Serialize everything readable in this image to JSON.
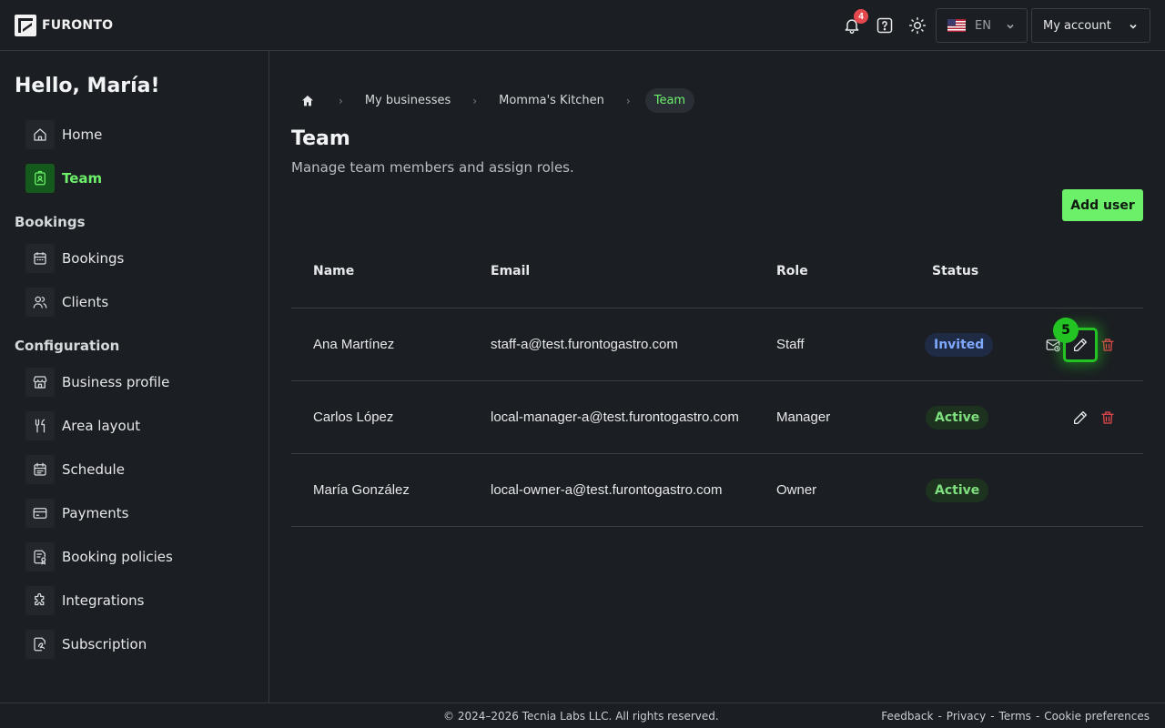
{
  "header": {
    "brand": "FURONTO",
    "notifications_count": "4",
    "language": "EN",
    "account_label": "My account"
  },
  "sidebar": {
    "greeting": "Hello, María!",
    "top_items": [
      {
        "label": "Home",
        "icon": "home-icon"
      },
      {
        "label": "Team",
        "icon": "badge-icon",
        "active": true
      }
    ],
    "bookings_section": "Bookings",
    "bookings_items": [
      {
        "label": "Bookings",
        "icon": "calendar-icon"
      },
      {
        "label": "Clients",
        "icon": "users-icon"
      }
    ],
    "config_section": "Configuration",
    "config_items": [
      {
        "label": "Business profile",
        "icon": "store-icon"
      },
      {
        "label": "Area layout",
        "icon": "utensils-icon"
      },
      {
        "label": "Schedule",
        "icon": "schedule-icon"
      },
      {
        "label": "Payments",
        "icon": "card-icon"
      },
      {
        "label": "Booking policies",
        "icon": "policy-icon"
      },
      {
        "label": "Integrations",
        "icon": "puzzle-icon"
      },
      {
        "label": "Subscription",
        "icon": "subscription-icon"
      }
    ]
  },
  "breadcrumb": {
    "items": [
      "My businesses",
      "Momma's Kitchen",
      "Team"
    ]
  },
  "page": {
    "title": "Team",
    "subtitle": "Manage team members and assign roles.",
    "add_user_label": "Add user"
  },
  "table": {
    "columns": [
      "Name",
      "Email",
      "Role",
      "Status"
    ],
    "rows": [
      {
        "name": "Ana Martínez",
        "email": "staff-a@test.furontogastro.com",
        "role": "Staff",
        "status": "Invited"
      },
      {
        "name": "Carlos López",
        "email": "local-manager-a@test.furontogastro.com",
        "role": "Manager",
        "status": "Active"
      },
      {
        "name": "María González",
        "email": "local-owner-a@test.furontogastro.com",
        "role": "Owner",
        "status": "Active"
      }
    ]
  },
  "annotation": {
    "step": "5"
  },
  "footer": {
    "copyright": "© 2024–2026 Tecnia Labs LLC. All rights reserved.",
    "links": [
      "Feedback",
      "Privacy",
      "Terms",
      "Cookie preferences"
    ]
  },
  "colors": {
    "accent": "#6cf06a",
    "background": "#1b1e22",
    "invited": "#7fa8ff",
    "active": "#7ee07c",
    "danger": "#e5484d"
  }
}
